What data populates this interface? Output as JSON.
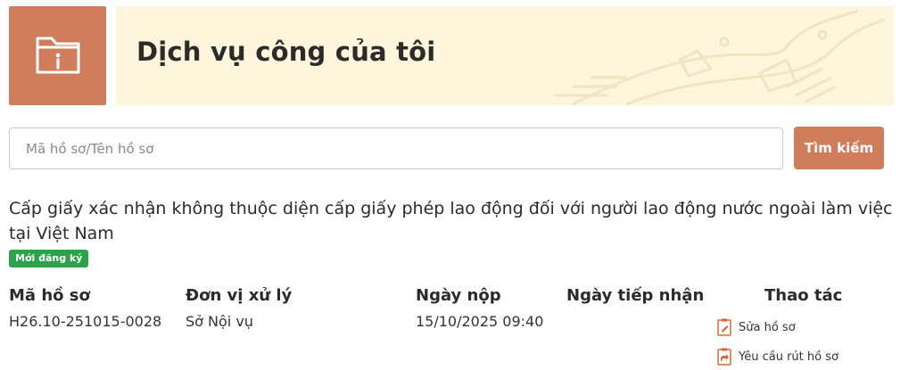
{
  "header": {
    "title": "Dịch vụ công của tôi",
    "icon": "folder-info-icon",
    "accent_color": "#cf7d5b",
    "banner_color": "#fdf6dc"
  },
  "search": {
    "placeholder": "Mã hồ sơ/Tên hồ sơ",
    "value": "",
    "button_label": "Tìm kiếm"
  },
  "record": {
    "title": "Cấp giấy xác nhận không thuộc diện cấp giấy phép lao động đối với người lao động nước ngoài làm việc tại Việt Nam",
    "status": "Mới đăng ký",
    "status_color": "#2ca24a"
  },
  "table": {
    "headers": {
      "code": "Mã hồ sơ",
      "unit": "Đơn vị xử lý",
      "submitted": "Ngày nộp",
      "received": "Ngày tiếp nhận",
      "actions": "Thao tác"
    },
    "row": {
      "code": "H26.10-251015-0028",
      "unit": "Sở Nội vụ",
      "submitted": "15/10/2025 09:40",
      "received": ""
    },
    "actions": [
      {
        "label": "Sửa hồ sơ",
        "icon": "edit-document-icon"
      },
      {
        "label": "Yêu cầu rút hồ sơ",
        "icon": "withdraw-document-icon"
      }
    ]
  }
}
